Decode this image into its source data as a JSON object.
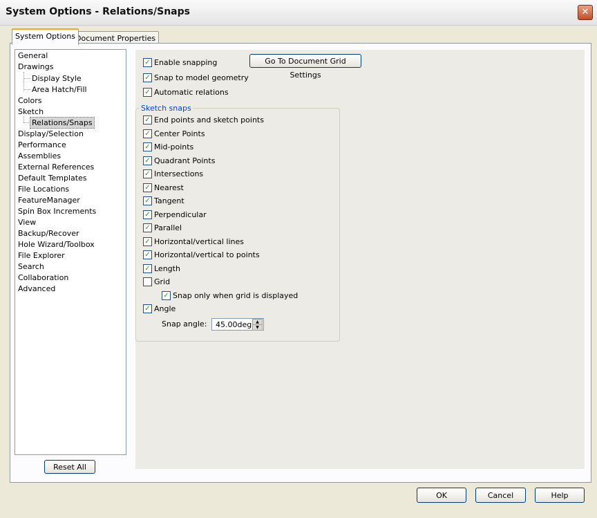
{
  "window": {
    "title": "System Options - Relations/Snaps",
    "close_glyph": "✕"
  },
  "tabs": [
    {
      "label": "System Options"
    },
    {
      "label": "Document Properties"
    }
  ],
  "tree": {
    "items": [
      {
        "label": "General"
      },
      {
        "label": "Drawings"
      },
      {
        "label": "Display Style"
      },
      {
        "label": "Area Hatch/Fill"
      },
      {
        "label": "Colors"
      },
      {
        "label": "Sketch"
      },
      {
        "label": "Relations/Snaps"
      },
      {
        "label": "Display/Selection"
      },
      {
        "label": "Performance"
      },
      {
        "label": "Assemblies"
      },
      {
        "label": "External References"
      },
      {
        "label": "Default Templates"
      },
      {
        "label": "File Locations"
      },
      {
        "label": "FeatureManager"
      },
      {
        "label": "Spin Box Increments"
      },
      {
        "label": "View"
      },
      {
        "label": "Backup/Recover"
      },
      {
        "label": "Hole Wizard/Toolbox"
      },
      {
        "label": "File Explorer"
      },
      {
        "label": "Search"
      },
      {
        "label": "Collaboration"
      },
      {
        "label": "Advanced"
      }
    ],
    "reset_label": "Reset All"
  },
  "options": {
    "enable_snapping": {
      "label": "Enable snapping",
      "checked": true
    },
    "snap_model": {
      "label": "Snap to model geometry",
      "checked": true
    },
    "auto_relations": {
      "label": "Automatic relations",
      "checked": true
    },
    "grid_settings_label": "Go To Document Grid Settings"
  },
  "sketch_snaps": {
    "title": "Sketch snaps",
    "items": [
      {
        "label": "End points and sketch points",
        "checked": true
      },
      {
        "label": "Center Points",
        "checked": true
      },
      {
        "label": "Mid-points",
        "checked": true
      },
      {
        "label": "Quadrant Points",
        "checked": true
      },
      {
        "label": "Intersections",
        "checked": true
      },
      {
        "label": "Nearest",
        "checked": true
      },
      {
        "label": "Tangent",
        "checked": true
      },
      {
        "label": "Perpendicular",
        "checked": true
      },
      {
        "label": "Parallel",
        "checked": true
      },
      {
        "label": "Horizontal/vertical lines",
        "checked": true
      },
      {
        "label": "Horizontal/vertical to points",
        "checked": true
      },
      {
        "label": "Length",
        "checked": true
      },
      {
        "label": "Grid",
        "checked": false
      },
      {
        "label": "Snap only when grid is displayed",
        "checked": true
      },
      {
        "label": "Angle",
        "checked": true
      }
    ],
    "snap_angle_label": "Snap angle:",
    "snap_angle_value": "45.00deg"
  },
  "buttons": {
    "ok": "OK",
    "cancel": "Cancel",
    "help": "Help"
  },
  "check_glyph": "✓"
}
